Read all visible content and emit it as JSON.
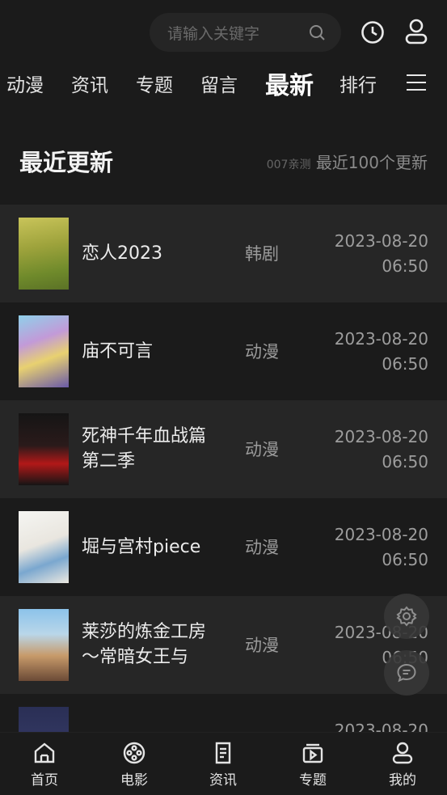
{
  "header": {
    "search_placeholder": "请输入关键字",
    "nav": [
      "动漫",
      "资讯",
      "专题",
      "留言",
      "最新",
      "排行"
    ],
    "active_nav": "最新"
  },
  "section": {
    "title": "最近更新",
    "sub_small": "007亲测",
    "sub": "最近100个更新"
  },
  "items": [
    {
      "title": "恋人2023",
      "category": "韩剧",
      "date": "2023-08-20",
      "time": "06:50"
    },
    {
      "title": "庙不可言",
      "category": "动漫",
      "date": "2023-08-20",
      "time": "06:50"
    },
    {
      "title": "死神千年血战篇第二季",
      "category": "动漫",
      "date": "2023-08-20",
      "time": "06:50"
    },
    {
      "title": "堀与宫村piece",
      "category": "动漫",
      "date": "2023-08-20",
      "time": "06:50"
    },
    {
      "title": "莱莎的炼金工房～常暗女王与秘…",
      "category": "动漫",
      "date": "2023-08-20",
      "time": "06:50"
    },
    {
      "title": "",
      "category": "",
      "date": "2023-08-20",
      "time": ""
    }
  ],
  "tabs": [
    "首页",
    "电影",
    "资讯",
    "专题",
    "我的"
  ],
  "colors": {
    "background": "#1b1b1b",
    "row_alt": "#262626",
    "text": "#e8e8e8",
    "muted": "#9d9d9d"
  }
}
